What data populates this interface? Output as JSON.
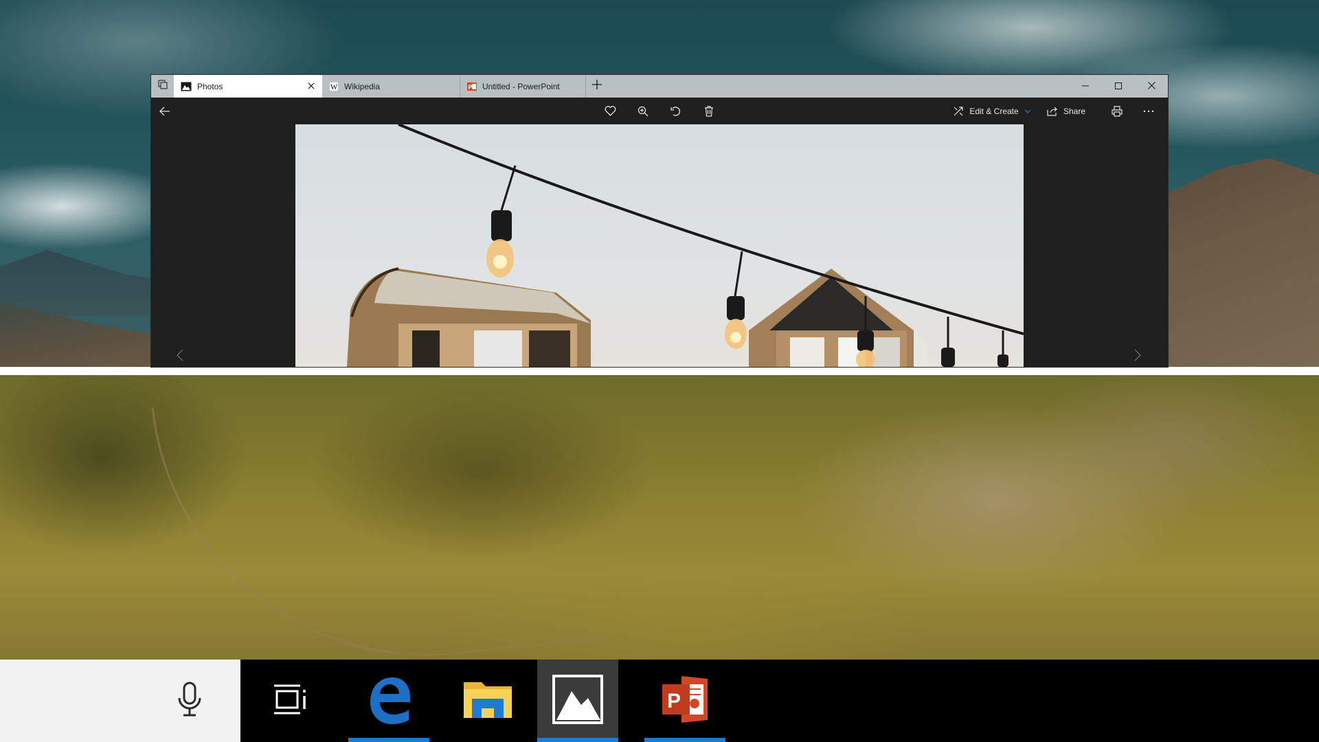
{
  "tabs": [
    {
      "label": "Photos",
      "icon": "photos-icon",
      "active": true
    },
    {
      "label": "Wikipedia",
      "icon": "wikipedia-icon",
      "active": false
    },
    {
      "label": "Untitled - PowerPoint",
      "icon": "powerpoint-icon",
      "active": false
    }
  ],
  "toolbar": {
    "edit_create_label": "Edit & Create",
    "share_label": "Share"
  },
  "taskbar": {
    "apps": [
      {
        "name": "task-view",
        "running": false
      },
      {
        "name": "edge",
        "running": true
      },
      {
        "name": "file-explorer",
        "running": false
      },
      {
        "name": "photos",
        "running": true,
        "active": true
      },
      {
        "name": "powerpoint",
        "running": true
      }
    ]
  },
  "colors": {
    "accent": "#1e7bd3",
    "tabbar": "#b8c0c4",
    "app_background": "#1f1f1f",
    "powerpoint": "#d24726",
    "edge": "#1e6fc6"
  }
}
